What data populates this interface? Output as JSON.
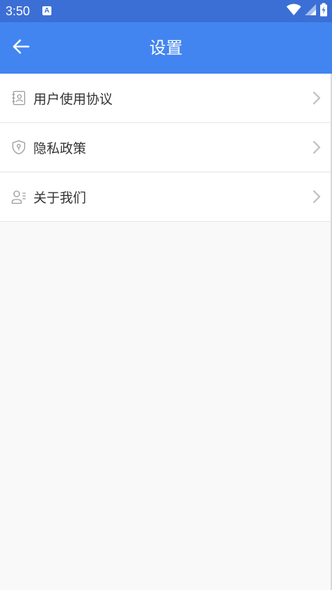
{
  "status_bar": {
    "time": "3:50",
    "notification_icon": "A",
    "icons": [
      "wifi-icon",
      "signal-icon",
      "battery-charging-icon"
    ]
  },
  "header": {
    "title": "设置",
    "back_icon": "arrow-left-icon"
  },
  "menu": {
    "items": [
      {
        "label": "用户使用协议",
        "icon": "contact-book-icon"
      },
      {
        "label": "隐私政策",
        "icon": "shield-icon"
      },
      {
        "label": "关于我们",
        "icon": "user-list-icon"
      }
    ]
  },
  "colors": {
    "status_bar": "#3b6fd6",
    "app_bar": "#4285f0",
    "background": "#f9f9f9",
    "list_background": "#ffffff",
    "text": "#333333",
    "icon": "#999999",
    "chevron": "#c4c4c4"
  }
}
